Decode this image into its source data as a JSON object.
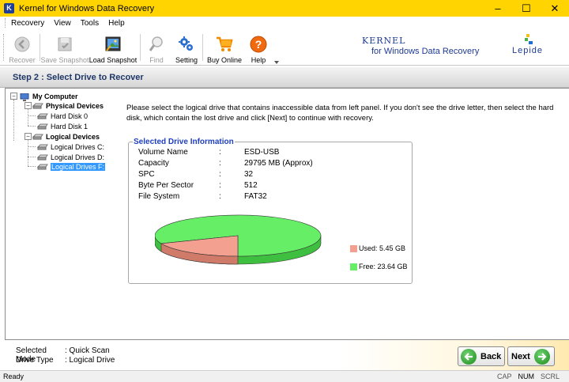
{
  "window": {
    "icon_letter": "K",
    "title": "Kernel for Windows Data Recovery",
    "controls": {
      "minimize": "–",
      "maximize": "☐",
      "close": "✕"
    }
  },
  "menu": {
    "items": [
      "Recovery",
      "View",
      "Tools",
      "Help"
    ]
  },
  "toolbar": {
    "recover": "Recover",
    "save_snapshot": "Save Snapshot",
    "load_snapshot": "Load Snapshot",
    "find": "Find",
    "setting": "Setting",
    "buy_online": "Buy Online",
    "help": "Help"
  },
  "brand": {
    "kernel": "Kernel",
    "subtitle": "for Windows Data Recovery",
    "lepide": "Lepide"
  },
  "step": {
    "title": "Step 2 : Select Drive to Recover"
  },
  "tree": {
    "root": "My Computer",
    "physical": "Physical Devices",
    "hd0": "Hard Disk 0",
    "hd1": "Hard Disk 1",
    "logical": "Logical Devices",
    "ldc": "Logical Drives C:",
    "ldd": "Logical Drives D:",
    "ldf": "Logical Drives F:"
  },
  "main": {
    "instructions": "Please select the logical drive that contains inaccessible data from left panel. If you don't see the drive letter, then select the hard disk, which contain the lost drive and click [Next] to continue with recovery."
  },
  "drive_info": {
    "title": "Selected Drive Information",
    "rows": [
      {
        "label": "Volume Name",
        "colon": ":",
        "value": "ESD-USB"
      },
      {
        "label": "Capacity",
        "colon": ":",
        "value": "29795 MB (Approx)"
      },
      {
        "label": "SPC",
        "colon": ":",
        "value": "32"
      },
      {
        "label": "Byte Per Sector",
        "colon": ":",
        "value": "512"
      },
      {
        "label": "File System",
        "colon": ":",
        "value": "FAT32"
      }
    ]
  },
  "chart_data": {
    "type": "pie",
    "slices": [
      {
        "label": "Used: 5.45 GB",
        "value": 5.45,
        "color": "#f4a090"
      },
      {
        "label": "Free: 23.64 GB",
        "value": 23.64,
        "color": "#66ee66"
      }
    ]
  },
  "footer": {
    "mode_label": "Selected Mode",
    "mode_value": ": Quick Scan",
    "drive_type_label": "Drive Type",
    "drive_type_value": ": Logical Drive",
    "back": "Back",
    "next": "Next"
  },
  "status": {
    "left": "Ready",
    "cap": "CAP",
    "num": "NUM",
    "scrl": "SCRL"
  },
  "colors": {
    "titlebar": "#ffd400",
    "accent_blue": "#1f3a93",
    "selection": "#3399ff"
  }
}
